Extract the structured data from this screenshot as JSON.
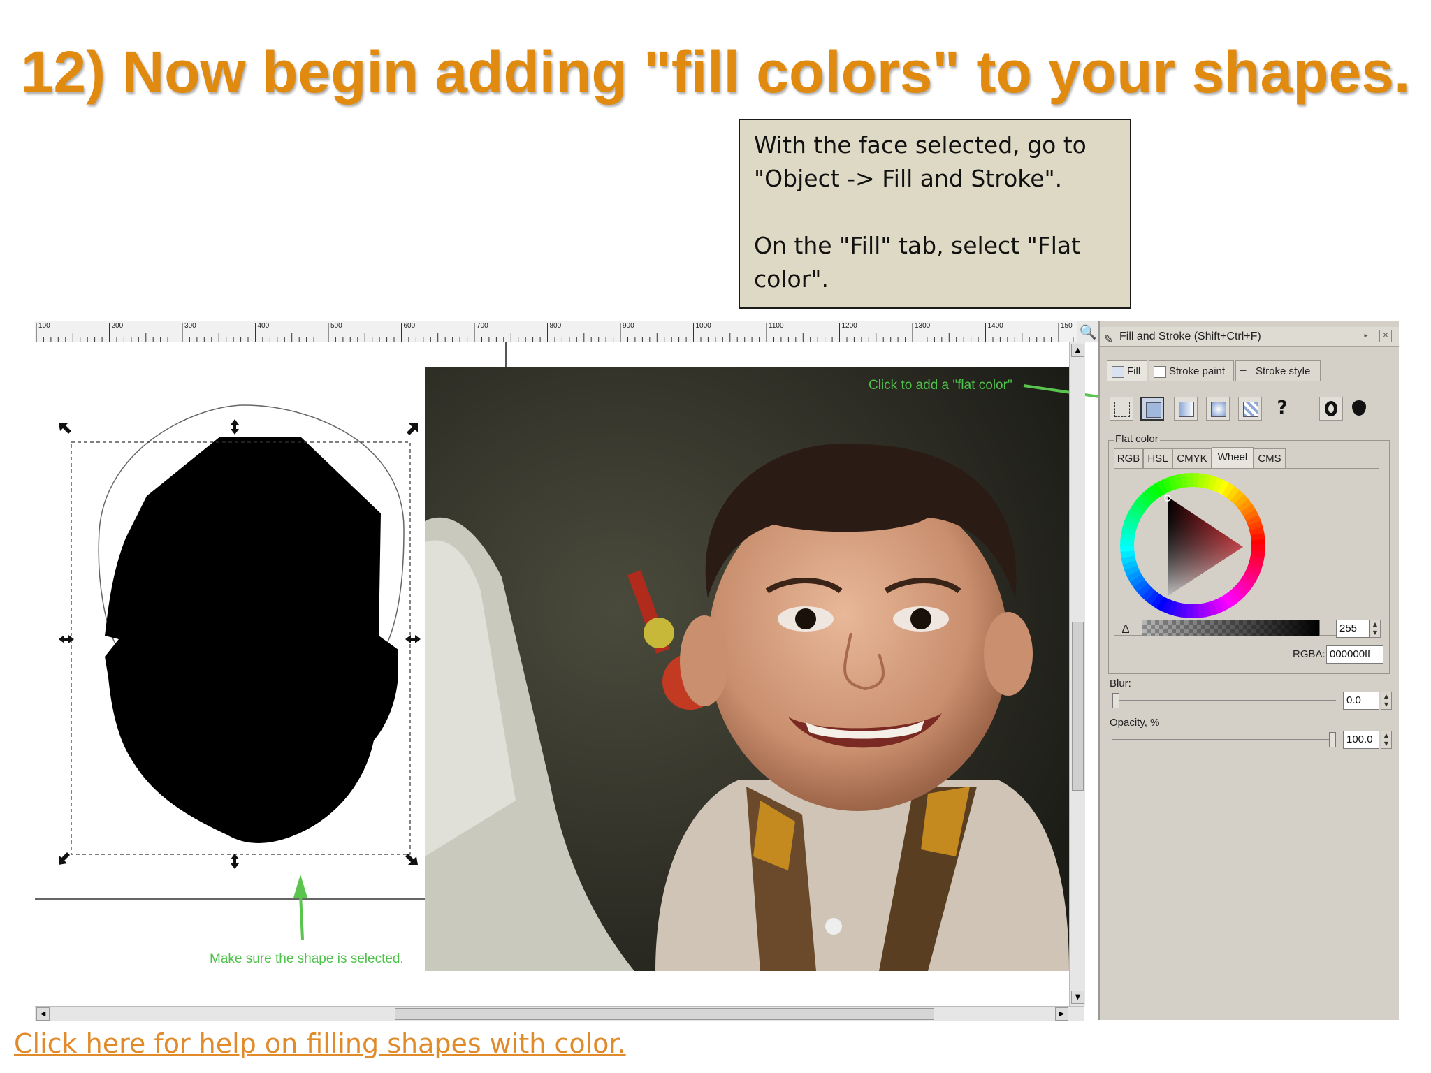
{
  "slide": {
    "title": "12) Now begin adding \"fill colors\" to your shapes.",
    "callout": "With the face selected, go to \"Object -> Fill and Stroke\".\n\nOn the \"Fill\" tab, select \"Flat color\".",
    "help_link": "Click here for help on filling shapes with color.",
    "title_color": "#e08a10",
    "callout_bg": "#ddd9c4"
  },
  "ruler": {
    "labels": [
      "100",
      "200",
      "300",
      "400",
      "500",
      "600",
      "700",
      "800",
      "900",
      "1000",
      "1100",
      "1200",
      "1300",
      "1400",
      "150"
    ]
  },
  "canvas": {
    "note_flat_color": "Click to add a \"flat color\"",
    "note_selected": "Make sure the shape is selected.",
    "note_color": "#4ec24a"
  },
  "panel": {
    "title": "Fill and Stroke (Shift+Ctrl+F)",
    "tabs": [
      "Fill",
      "Stroke paint",
      "Stroke style"
    ],
    "group_label": "Flat color",
    "subtabs": [
      "RGB",
      "HSL",
      "CMYK",
      "Wheel",
      "CMS"
    ],
    "alpha_label": "A",
    "alpha_value": "255",
    "rgba_label": "RGBA:",
    "rgba_value": "000000ff",
    "blur_label": "Blur:",
    "blur_value": "0.0",
    "opacity_label": "Opacity, %",
    "opacity_value": "100.0",
    "unset_help": "?"
  }
}
